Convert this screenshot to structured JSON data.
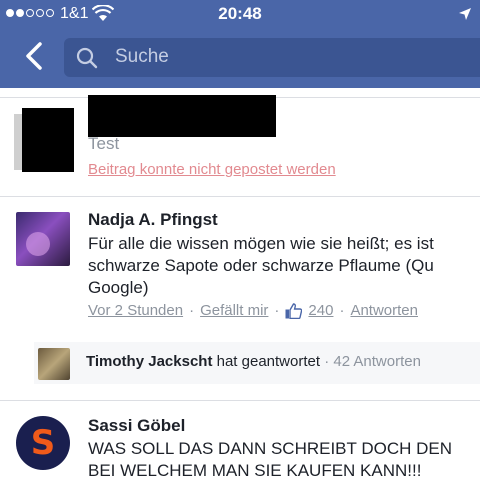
{
  "status_bar": {
    "carrier": "1&1",
    "time": "20:48"
  },
  "search": {
    "placeholder": "Suche"
  },
  "failed_post": {
    "text": "Test",
    "error": "Beitrag konnte nicht gepostet werden"
  },
  "comments": [
    {
      "author": "Nadja A. Pfingst",
      "lines": [
        "Für alle die wissen mögen wie sie heißt; es ist",
        "schwarze Sapote oder schwarze Pflaume (Qu",
        "Google)"
      ],
      "time": "Vor 2 Stunden",
      "like_label": "Gefällt mir",
      "like_count": "240",
      "reply_label": "Antworten",
      "reply_summary": {
        "name": "Timothy Jackscht",
        "action": "hat geantwortet",
        "count": "· 42 Antworten"
      }
    },
    {
      "author": "Sassi Göbel",
      "lines": [
        "WAS SOLL DAS DANN SCHREIBT DOCH DEN",
        "BEI WELCHEM MAN SIE KAUFEN KANN!!!"
      ]
    }
  ],
  "colors": {
    "header_blue": "#4a66a8",
    "search_bg": "#3b5592",
    "link_grey": "#8d949e",
    "error_red": "#e28a90",
    "like_blue": "#4a66a8"
  },
  "icons": {
    "back": "back-chevron-icon",
    "search": "search-icon",
    "wifi": "wifi-icon",
    "location": "location-arrow-icon",
    "like": "thumbs-up-icon"
  }
}
